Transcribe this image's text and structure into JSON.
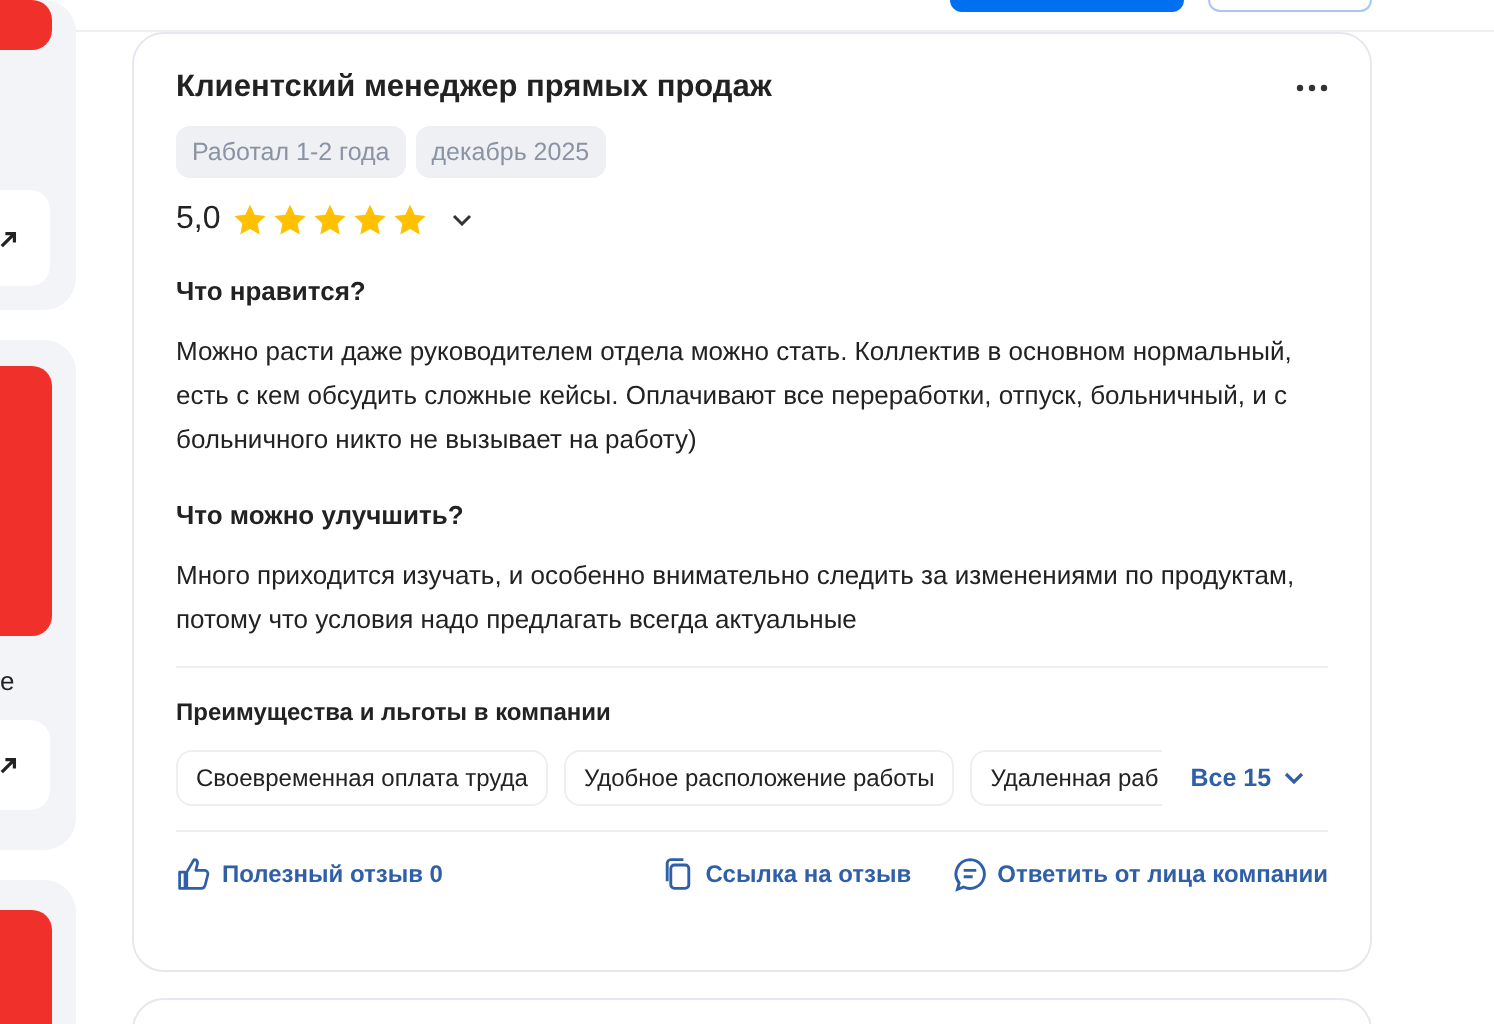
{
  "side": {
    "cut_text": "e"
  },
  "review": {
    "title": "Клиентский менеджер прямых продаж",
    "tags": [
      "Работал 1-2 года",
      "декабрь 2025"
    ],
    "rating": "5,0",
    "stars": 5,
    "sections": [
      {
        "heading": "Что нравится?",
        "text": "Можно расти даже руководителем отдела можно стать. Коллектив в основном нормальный, есть с кем обсудить сложные кейсы. Оплачивают все переработки, отпуск, больничный, и с больничного никто не вызывает на работу)"
      },
      {
        "heading": "Что можно улучшить?",
        "text": "Много приходится изучать, и особенно внимательно следить за изменениями по продуктам, потому что условия надо предлагать всегда актуальные"
      }
    ],
    "benefits_title": "Преимущества и льготы в компании",
    "benefits": [
      "Своевременная оплата труда",
      "Удобное расположение работы",
      "Удаленная раб"
    ],
    "all_benefits": "Все 15",
    "actions": [
      {
        "kind": "like",
        "label": "Полезный отзыв 0"
      },
      {
        "kind": "link",
        "label": "Ссылка на отзыв"
      },
      {
        "kind": "reply",
        "label": "Ответить от лица компании"
      }
    ]
  }
}
